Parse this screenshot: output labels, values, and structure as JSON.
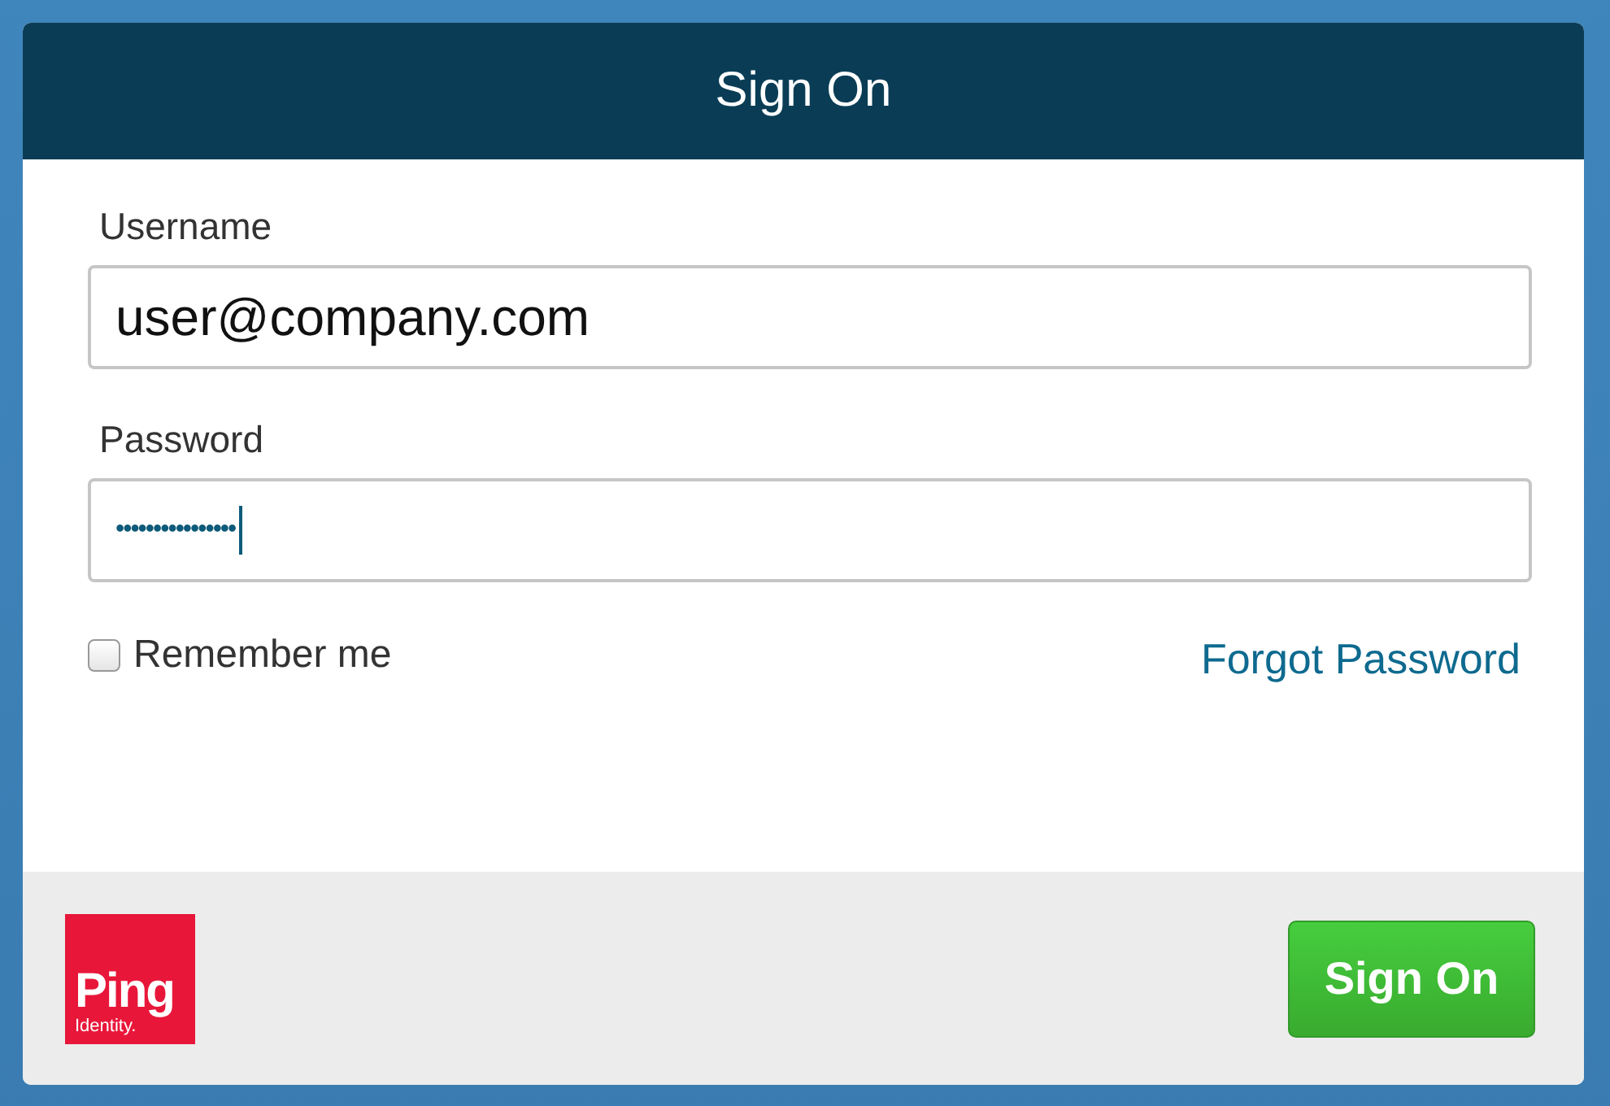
{
  "header": {
    "title": "Sign On"
  },
  "fields": [
    {
      "label": "Username",
      "value": "user@company.com",
      "kind": "text"
    },
    {
      "label": "Password",
      "value": "••••••••••••••••",
      "kind": "password"
    }
  ],
  "remember": {
    "label": "Remember me",
    "checked": false
  },
  "forgot_link": "Forgot Password",
  "logo": {
    "word": "Ping",
    "subword": "Identity."
  },
  "submit_button": "Sign On"
}
